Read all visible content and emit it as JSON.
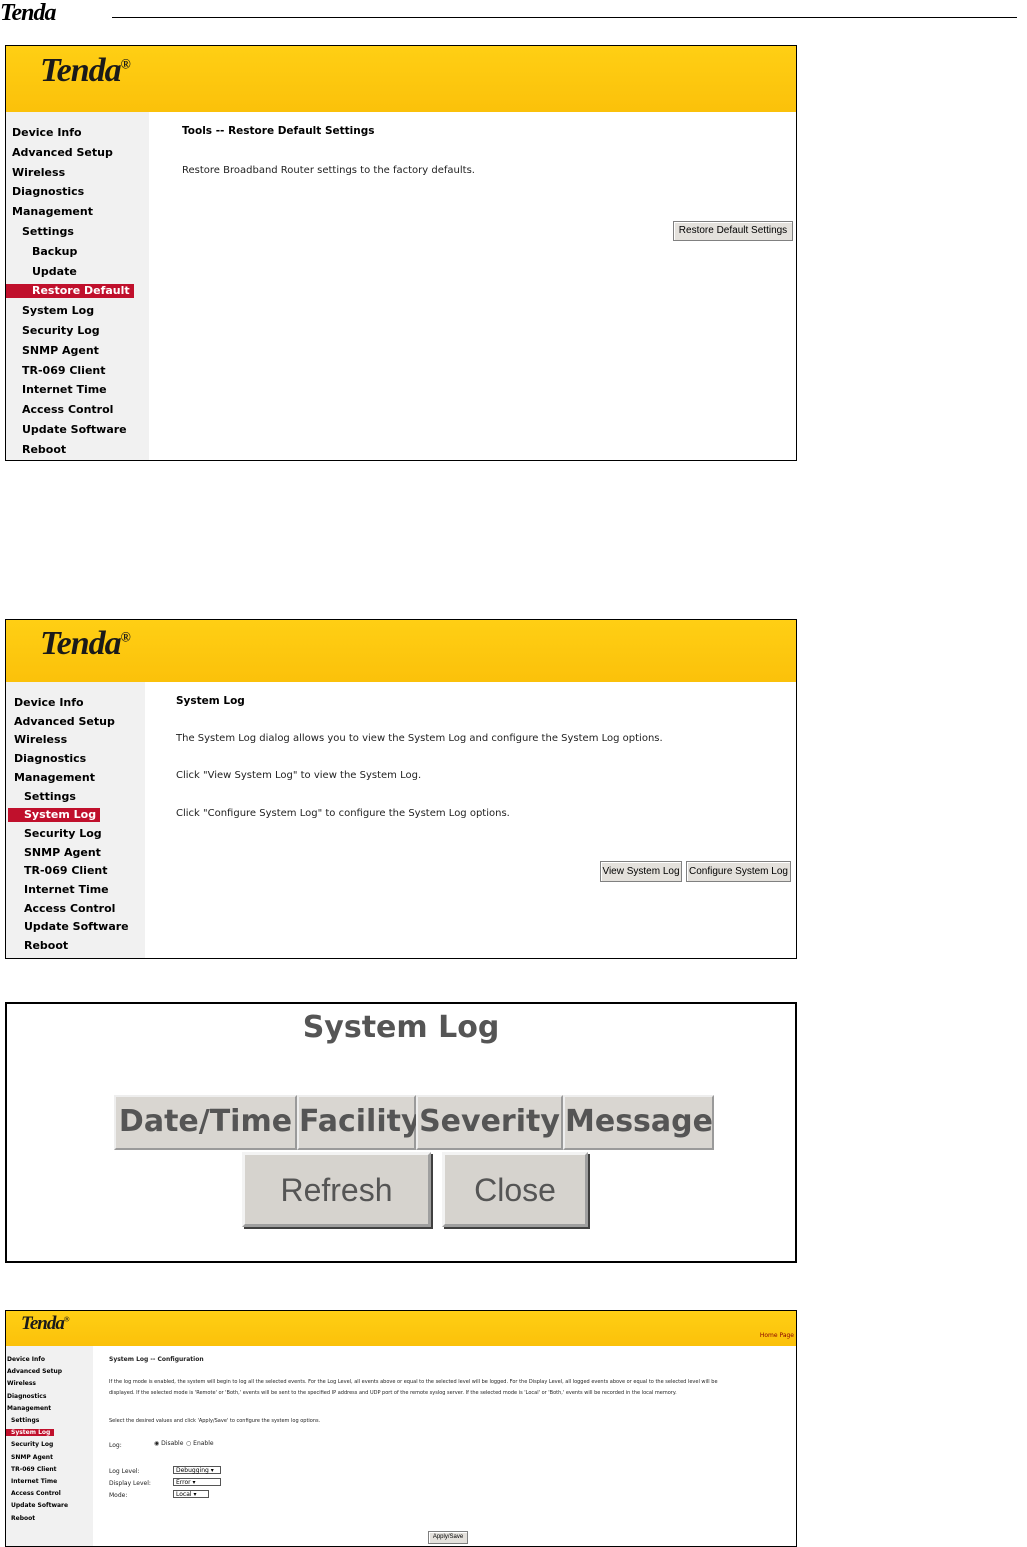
{
  "doc_logo": "Tenda",
  "shot1": {
    "brand": "Tenda",
    "nav": [
      "Device Info",
      "Advanced Setup",
      "Wireless",
      "Diagnostics",
      "Management",
      "Settings",
      "Backup",
      "Update",
      "Restore Default",
      "System Log",
      "Security Log",
      "SNMP Agent",
      "TR-069 Client",
      "Internet Time",
      "Access Control",
      "Update Software",
      "Reboot"
    ],
    "active": "Restore Default",
    "title": "Tools -- Restore Default Settings",
    "desc": "Restore Broadband Router settings to the factory defaults.",
    "button": "Restore Default Settings"
  },
  "shot2": {
    "brand": "Tenda",
    "nav": [
      "Device Info",
      "Advanced Setup",
      "Wireless",
      "Diagnostics",
      "Management",
      "Settings",
      "System Log",
      "Security Log",
      "SNMP Agent",
      "TR-069 Client",
      "Internet Time",
      "Access Control",
      "Update Software",
      "Reboot"
    ],
    "active": "System Log",
    "title": "System Log",
    "line1": "The System Log dialog allows you to view the System Log and configure the System Log options.",
    "line2": "Click \"View System Log\" to view the System Log.",
    "line3": "Click \"Configure System Log\" to configure the System Log options.",
    "view_button": "View System Log",
    "config_button": "Configure System Log"
  },
  "shot3": {
    "title": "System Log",
    "columns": [
      "Date/Time",
      "Facility",
      "Severity",
      "Message"
    ],
    "refresh": "Refresh",
    "close": "Close"
  },
  "shot4": {
    "brand": "Tenda",
    "home_link": "Home Page",
    "nav": [
      "Device Info",
      "Advanced Setup",
      "Wireless",
      "Diagnostics",
      "Management",
      "Settings",
      "System Log",
      "Security Log",
      "SNMP Agent",
      "TR-069 Client",
      "Internet Time",
      "Access Control",
      "Update Software",
      "Reboot"
    ],
    "active": "System Log",
    "title": "System Log -- Configuration",
    "para1": "If the log mode is enabled, the system will begin to log all the selected events. For the Log Level, all events above or equal to the selected level will be logged. For the Display Level, all logged events above or equal to the selected level will be",
    "para2": "displayed. If the selected mode is 'Remote' or 'Both,' events will be sent to the specified IP address and UDP port of the remote syslog server. If the selected mode is 'Local' or 'Both,' events will be recorded in the local memory.",
    "para3": "Select the desired values and click 'Apply/Save' to configure the system log options.",
    "log_label": "Log:",
    "disable": "Disable",
    "enable": "Enable",
    "log_level_label": "Log Level:",
    "log_level_value": "Debugging",
    "display_level_label": "Display Level:",
    "display_level_value": "Error",
    "mode_label": "Mode:",
    "mode_value": "Local",
    "apply": "Apply/Save"
  }
}
